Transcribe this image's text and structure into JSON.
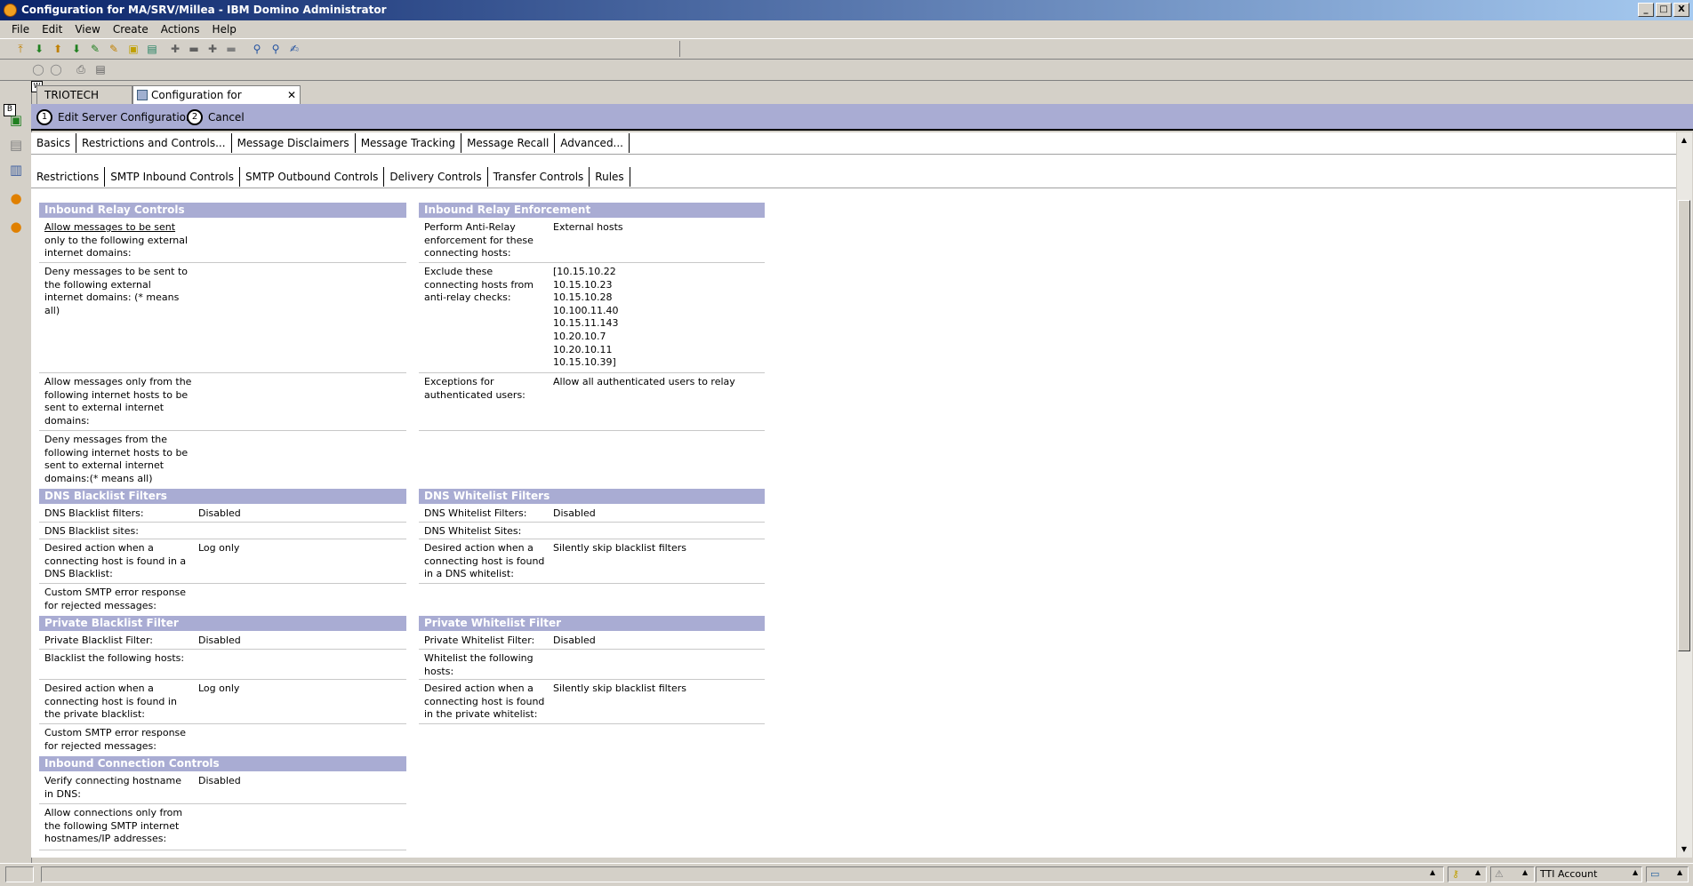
{
  "window": {
    "title": "Configuration for MA/SRV/Millea - IBM Domino Administrator",
    "controls": {
      "minimize": "_",
      "maximize": "□",
      "close": "X"
    }
  },
  "menu": [
    "File",
    "Edit",
    "View",
    "Create",
    "Actions",
    "Help"
  ],
  "sidebar_badges": {
    "b": "B",
    "w": "W"
  },
  "window_tabs": [
    {
      "label": "TRIOTECH Domain"
    },
    {
      "label": "Configuration for MA/SRV/Millea",
      "close": "✕"
    }
  ],
  "actions": [
    {
      "num": "1",
      "label": "Edit Server Configuration"
    },
    {
      "num": "2",
      "label": "Cancel"
    }
  ],
  "main_tabs": [
    "Basics",
    "Restrictions and Controls...",
    "Message Disclaimers",
    "Message Tracking",
    "Message Recall",
    "Advanced..."
  ],
  "sub_tabs": [
    "Restrictions",
    "SMTP Inbound Controls",
    "SMTP Outbound Controls",
    "Delivery Controls",
    "Transfer Controls",
    "Rules"
  ],
  "left": {
    "inbound_relay": {
      "title": "Inbound Relay Controls",
      "allow_sent_link": "Allow messages to be sent",
      "allow_sent_rest": "only to the following external internet domains:",
      "deny_sent": "Deny messages to be sent to the following external internet domains: (* means all)",
      "allow_from": "Allow messages only from the following internet hosts to be sent to external internet domains:",
      "deny_from": "Deny messages from the following internet hosts to be sent to external internet domains:(* means all)"
    },
    "dns_blacklist": {
      "title": "DNS Blacklist Filters",
      "filters_label": "DNS Blacklist filters:",
      "filters_value": "Disabled",
      "sites_label": "DNS Blacklist sites:",
      "action_label": "Desired action when a connecting host is found in a DNS Blacklist:",
      "action_value": "Log only",
      "custom_label": "Custom SMTP error response for rejected messages:"
    },
    "private_blacklist": {
      "title": "Private Blacklist Filter",
      "filter_label": "Private Blacklist Filter:",
      "filter_value": "Disabled",
      "hosts_label": "Blacklist the following hosts:",
      "action_label": "Desired action when a connecting host is found in the private blacklist:",
      "action_value": "Log only",
      "custom_label": "Custom SMTP error response for rejected messages:"
    },
    "inbound_connection": {
      "title": "Inbound Connection Controls",
      "verify_label": "Verify connecting hostname in DNS:",
      "verify_value": "Disabled",
      "allow_label": "Allow connections only from the following SMTP internet hostnames/IP addresses:"
    }
  },
  "right": {
    "enforcement": {
      "title": "Inbound Relay Enforcement",
      "perform_label": "Perform Anti-Relay enforcement for these connecting hosts:",
      "perform_value": "External hosts",
      "exclude_label": "Exclude these connecting hosts from anti-relay checks:",
      "exclude_values": [
        "[10.15.10.22",
        "10.15.10.23",
        "10.15.10.28",
        "10.100.11.40",
        "10.15.11.143",
        "10.20.10.7",
        "10.20.10.11",
        "10.15.10.39]"
      ],
      "exceptions_label": "Exceptions for authenticated users:",
      "exceptions_value": "Allow all authenticated users to relay"
    },
    "dns_whitelist": {
      "title": "DNS Whitelist Filters",
      "filters_label": "DNS Whitelist Filters:",
      "filters_value": "Disabled",
      "sites_label": "DNS Whitelist Sites:",
      "action_label": "Desired action when a connecting host is found in a DNS whitelist:",
      "action_value": "Silently skip blacklist filters"
    },
    "private_whitelist": {
      "title": "Private Whitelist Filter",
      "filter_label": "Private Whitelist Filter:",
      "filter_value": "Disabled",
      "hosts_label": "Whitelist the following hosts:",
      "action_label": "Desired action when a connecting host is found in the private whitelist:",
      "action_value": "Silently skip blacklist filters"
    }
  },
  "status": {
    "account": "TTI Account"
  }
}
